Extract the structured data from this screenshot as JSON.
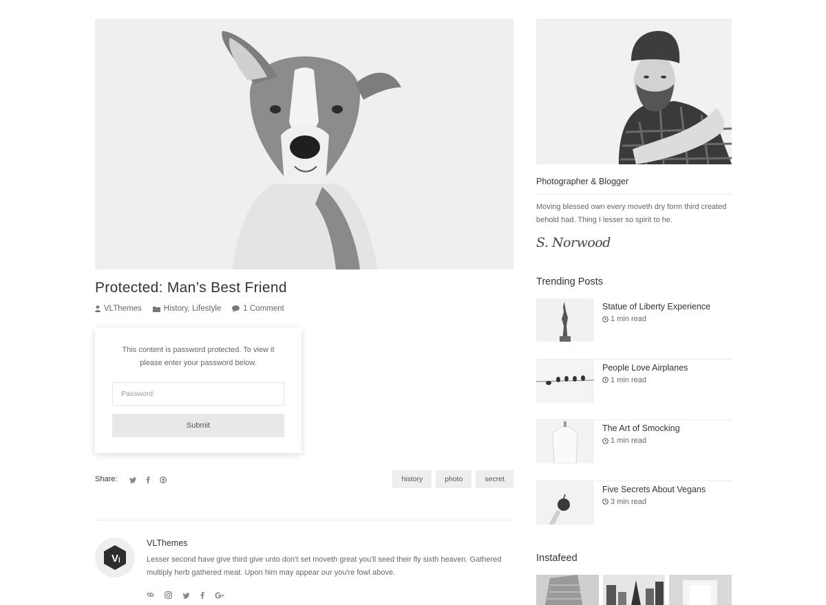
{
  "post": {
    "title": "Protected: Man’s Best Friend",
    "meta": {
      "author": "VLThemes",
      "categories": "History, Lifestyle",
      "comments": "1 Comment",
      "author_icon": "user-icon",
      "category_icon": "folder-icon",
      "comment_icon": "comment-icon"
    },
    "password_form": {
      "message": "This content is password protected. To view it please enter your password below.",
      "placeholder": "Password:",
      "submit_label": "Submit"
    },
    "share": {
      "label": "Share:",
      "icons": [
        "twitter-icon",
        "facebook-icon",
        "pinterest-icon"
      ]
    },
    "tags": [
      "history",
      "photo",
      "secret"
    ]
  },
  "author_box": {
    "name": "VLThemes",
    "bio": "Lesser second have give third give unto don't set moveth great you'll seed their fly sixth heaven. Gathered multiply herb gathered meat. Upon him may appear our you're fowl above.",
    "icons": [
      "link-icon",
      "instagram-icon",
      "twitter-icon",
      "facebook-icon",
      "google-plus-icon"
    ]
  },
  "sidebar": {
    "profile": {
      "title": "Photographer & Blogger",
      "description": "Moving blessed own every moveth dry form third created behold had. Thing I lesser so spirit to he.",
      "signature": "S. Norwood"
    },
    "trending": {
      "title": "Trending Posts",
      "items": [
        {
          "title": "Statue of Liberty Experience",
          "read": "1 min read"
        },
        {
          "title": "People Love Airplanes",
          "read": "1 min read"
        },
        {
          "title": "The Art of Smocking",
          "read": "1 min read"
        },
        {
          "title": "Five Secrets About Vegans",
          "read": "3 min read"
        }
      ]
    },
    "instafeed": {
      "title": "Instafeed"
    }
  },
  "colors": {
    "text": "#333333",
    "muted": "#666666",
    "tag_bg": "#eeeeee",
    "button_bg": "#e8e8e8"
  }
}
